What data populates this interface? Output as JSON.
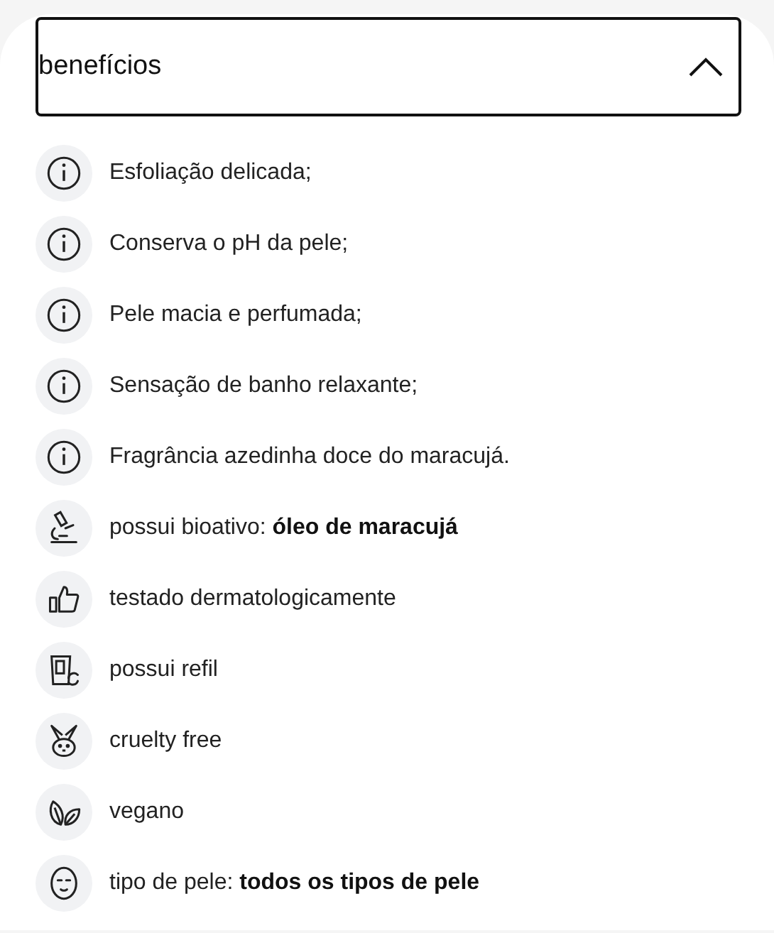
{
  "accordion": {
    "title": "benefícios",
    "expanded": true
  },
  "items": [
    {
      "kind": "info",
      "text": "Esfoliação delicada;"
    },
    {
      "kind": "info",
      "text": "Conserva o pH da pele;"
    },
    {
      "kind": "info",
      "text": "Pele macia e perfumada;"
    },
    {
      "kind": "info",
      "text": "Sensação de banho relaxante;"
    },
    {
      "kind": "info",
      "text": "Fragrância azedinha doce do maracujá."
    },
    {
      "kind": "microscope",
      "text": "possui bioativo: **óleo de maracujá**"
    },
    {
      "kind": "thumbs-up",
      "text": "testado dermatologicamente"
    },
    {
      "kind": "refill",
      "text": "possui refil"
    },
    {
      "kind": "rabbit",
      "text": "cruelty free"
    },
    {
      "kind": "leaves",
      "text": "vegano"
    },
    {
      "kind": "face",
      "text": "tipo de pele: **todos os tipos de pele**"
    }
  ]
}
